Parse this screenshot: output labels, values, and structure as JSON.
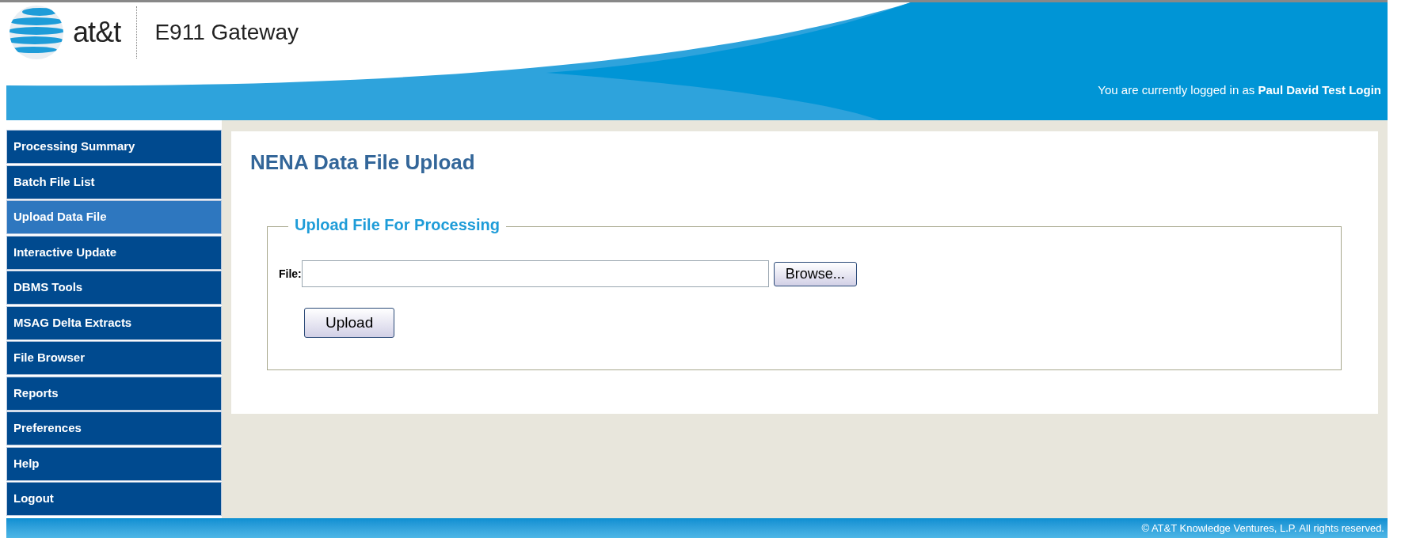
{
  "header": {
    "logo_text": "at&t",
    "app_title": "E911 Gateway",
    "login_prefix": "You are currently logged in as",
    "user_name": "Paul David Test Login"
  },
  "sidebar": {
    "items": [
      {
        "label": "Processing Summary",
        "selected": false
      },
      {
        "label": "Batch File List",
        "selected": false
      },
      {
        "label": "Upload Data File",
        "selected": true
      },
      {
        "label": "Interactive Update",
        "selected": false
      },
      {
        "label": "DBMS Tools",
        "selected": false
      },
      {
        "label": "MSAG Delta Extracts",
        "selected": false
      },
      {
        "label": "File Browser",
        "selected": false
      },
      {
        "label": "Reports",
        "selected": false
      },
      {
        "label": "Preferences",
        "selected": false
      },
      {
        "label": "Help",
        "selected": false
      },
      {
        "label": "Logout",
        "selected": false
      }
    ]
  },
  "content": {
    "title": "NENA Data File Upload",
    "fieldset": {
      "legend": "Upload File For Processing",
      "file_label": "File:",
      "browse_button": "Browse...",
      "upload_button": "Upload"
    }
  },
  "footer": {
    "copyright": "© AT&T Knowledge Ventures, L.P. All rights reserved."
  }
}
